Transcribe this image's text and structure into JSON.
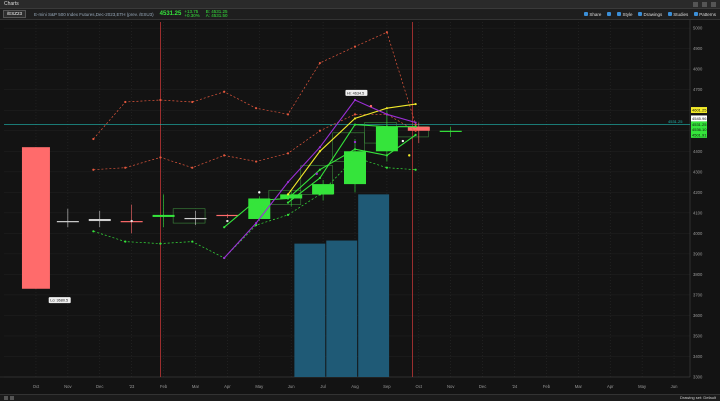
{
  "window": {
    "title": "Charts"
  },
  "toolbar": {
    "symbol": "/ESZ23",
    "description": "E-mini S&P 500 Index Futures,Dec-2023,ETH (prev. /ESU3)",
    "last_price": "4531.25",
    "change": "+13.75",
    "change_pct": "+0.30%",
    "bid": "B: 4531.25",
    "ask": "A: 4531.50",
    "share_label": "Share",
    "style_label": "Style",
    "drawings_label": "Drawings",
    "studies_label": "Studies",
    "patterns_label": "Patterns"
  },
  "status": {
    "drawing_set": "Drawing set: Default"
  },
  "colors": {
    "up": "#35e43b",
    "down": "#ff6b6b",
    "purple": "#9b2fd6",
    "yellow": "#f2ea2a",
    "volume": "#1f5a76",
    "orange": "#e4573d",
    "cyan": "#1fb7b0"
  },
  "chart_data": {
    "type": "candlestick",
    "x_ticks": [
      "Oct",
      "Nov",
      "Dec",
      "'23",
      "Feb",
      "Mar",
      "Apr",
      "May",
      "Jun",
      "Jul",
      "Aug",
      "Sep",
      "Oct",
      "Nov",
      "Dec",
      "'24",
      "Feb",
      "Mar",
      "Apr",
      "May",
      "Jun"
    ],
    "y_ticks": [
      5000,
      4900,
      4800,
      4700,
      4600,
      4500,
      4400,
      4300,
      4200,
      4100,
      4000,
      3900,
      3800,
      3700,
      3600,
      3500,
      3400,
      3300
    ],
    "ylim": [
      3300,
      5030
    ],
    "candles": [
      {
        "o": 4420,
        "h": 4420,
        "l": 3730,
        "c": 3730,
        "dir": "down"
      },
      {
        "o": 4060,
        "h": 4120,
        "l": 4030,
        "c": 4060,
        "dir": "flat"
      },
      {
        "o": 4070,
        "h": 4110,
        "l": 4030,
        "c": 4060,
        "dir": "flat"
      },
      {
        "o": 4060,
        "h": 4140,
        "l": 4000,
        "c": 4060,
        "dir": "down"
      },
      {
        "o": 4080,
        "h": 4190,
        "l": 4030,
        "c": 4090,
        "dir": "up"
      },
      {
        "o": 4075,
        "h": 4110,
        "l": 4040,
        "c": 4075,
        "dir": "flat"
      },
      {
        "o": 4090,
        "h": 4095,
        "l": 4075,
        "c": 4085,
        "dir": "down"
      },
      {
        "o": 4070,
        "h": 4180,
        "l": 4060,
        "c": 4170,
        "dir": "up"
      },
      {
        "o": 4170,
        "h": 4210,
        "l": 4130,
        "c": 4190,
        "dir": "up"
      },
      {
        "o": 4190,
        "h": 4260,
        "l": 4160,
        "c": 4240,
        "dir": "up"
      },
      {
        "o": 4240,
        "h": 4460,
        "l": 4200,
        "c": 4400,
        "dir": "up"
      },
      {
        "o": 4400,
        "h": 4600,
        "l": 4350,
        "c": 4520,
        "dir": "up"
      },
      {
        "o": 4520,
        "h": 4540,
        "l": 4440,
        "c": 4500,
        "dir": "down"
      },
      {
        "o": 4500,
        "h": 4520,
        "l": 4470,
        "c": 4500,
        "dir": "up"
      }
    ],
    "volume": [
      {
        "from": 8.6,
        "to": 9.6,
        "value": 3950
      },
      {
        "from": 9.6,
        "to": 10.6,
        "value": 3965
      },
      {
        "from": 10.6,
        "to": 11.6,
        "value": 4190
      }
    ],
    "series": [
      {
        "name": "",
        "color": "#e4573d",
        "style": "dashed",
        "points": [
          [
            2.3,
            4460
          ],
          [
            3.3,
            4640
          ],
          [
            4.4,
            4650
          ],
          [
            5.4,
            4640
          ],
          [
            6.4,
            4690
          ],
          [
            7.4,
            4610
          ],
          [
            8.4,
            4580
          ],
          [
            9.4,
            4830
          ],
          [
            10.5,
            4910
          ],
          [
            11.5,
            4980
          ],
          [
            12.4,
            4530
          ]
        ]
      },
      {
        "name": "",
        "color": "#e4573d",
        "style": "dashed",
        "points": [
          [
            2.3,
            4310
          ],
          [
            3.3,
            4320
          ],
          [
            4.4,
            4370
          ],
          [
            5.4,
            4320
          ],
          [
            6.4,
            4380
          ],
          [
            7.4,
            4350
          ],
          [
            8.4,
            4390
          ],
          [
            9.4,
            4500
          ],
          [
            10.5,
            4580
          ],
          [
            11.5,
            4580
          ],
          [
            12.4,
            4500
          ]
        ]
      },
      {
        "name": "",
        "color": "#35e43b",
        "style": "dashed",
        "points": [
          [
            2.3,
            4010
          ],
          [
            3.3,
            3960
          ],
          [
            4.4,
            3950
          ],
          [
            5.4,
            3960
          ],
          [
            6.4,
            3880
          ],
          [
            7.4,
            4040
          ],
          [
            8.4,
            4090
          ],
          [
            9.4,
            4190
          ],
          [
            10.5,
            4370
          ],
          [
            11.5,
            4320
          ],
          [
            12.4,
            4310
          ]
        ]
      },
      {
        "name": "",
        "color": "#35e43b",
        "style": "solid",
        "points": [
          [
            6.4,
            4030
          ],
          [
            7.4,
            4160
          ],
          [
            8.4,
            4170
          ],
          [
            9.4,
            4310
          ],
          [
            10.5,
            4410
          ],
          [
            11.5,
            4380
          ],
          [
            12.4,
            4480
          ]
        ]
      },
      {
        "name": "",
        "color": "#35e43b",
        "style": "solid",
        "points": [
          [
            8.4,
            4150
          ],
          [
            9.4,
            4270
          ],
          [
            10.5,
            4530
          ],
          [
            11.5,
            4520
          ],
          [
            12.4,
            4520
          ]
        ]
      },
      {
        "name": "",
        "color": "#f2ea2a",
        "style": "solid",
        "points": [
          [
            8.4,
            4190
          ],
          [
            9.4,
            4400
          ],
          [
            10.5,
            4560
          ],
          [
            11.5,
            4610
          ],
          [
            12.4,
            4630
          ]
        ]
      },
      {
        "name": "",
        "color": "#9b2fd6",
        "style": "solid",
        "points": [
          [
            6.4,
            3880
          ],
          [
            7.4,
            4050
          ],
          [
            8.4,
            4250
          ],
          [
            9.4,
            4420
          ],
          [
            10.5,
            4650
          ],
          [
            11.5,
            4580
          ],
          [
            12.4,
            4540
          ]
        ]
      }
    ],
    "markers": [
      {
        "x": 3.5,
        "y": 4060,
        "color": "#e4e4e4"
      },
      {
        "x": 6.5,
        "y": 4060,
        "color": "#e4e4e4"
      },
      {
        "x": 7.5,
        "y": 4200,
        "color": "#ffffff"
      },
      {
        "x": 9.3,
        "y": 4290,
        "color": "#9b2fd6"
      },
      {
        "x": 10.5,
        "y": 4445,
        "color": "#9b2fd6"
      },
      {
        "x": 11.0,
        "y": 4620,
        "color": "#ff6b6b"
      },
      {
        "x": 12.0,
        "y": 4450,
        "color": "#ffffff"
      },
      {
        "x": 12.2,
        "y": 4380,
        "color": "#f2ea2a"
      }
    ],
    "boxes": [
      {
        "x0": 4.8,
        "x1": 5.8,
        "y0": 4050,
        "y1": 4120
      },
      {
        "x0": 7.8,
        "x1": 8.8,
        "y0": 4140,
        "y1": 4210
      },
      {
        "x0": 8.8,
        "x1": 9.8,
        "y0": 4190,
        "y1": 4330
      },
      {
        "x0": 9.8,
        "x1": 10.8,
        "y0": 4350,
        "y1": 4490
      },
      {
        "x0": 10.8,
        "x1": 11.8,
        "y0": 4440,
        "y1": 4540
      },
      {
        "x0": 11.8,
        "x1": 12.8,
        "y0": 4470,
        "y1": 4520
      }
    ],
    "vlines": [
      4.4,
      12.3
    ],
    "current_price_line": 4531.25,
    "price_labels": [
      {
        "text": "4601.25",
        "color": "#f2ea2a",
        "y": 4601
      },
      {
        "text": "4545.96",
        "color": "#ffffff",
        "y": 4560
      },
      {
        "text": "4531.25",
        "color": "#35e43b",
        "y": 4531
      },
      {
        "text": "4536.10",
        "color": "#35e43b",
        "y": 4505
      },
      {
        "text": "4501.91",
        "color": "#35e43b",
        "y": 4480
      }
    ],
    "annotations": [
      {
        "text": "Hi: 4634.5",
        "x": 10.2,
        "y": 4680
      },
      {
        "text": "Lo: 3680.5",
        "x": 0.9,
        "y": 3670
      }
    ],
    "current_price_text": "4531.25"
  }
}
